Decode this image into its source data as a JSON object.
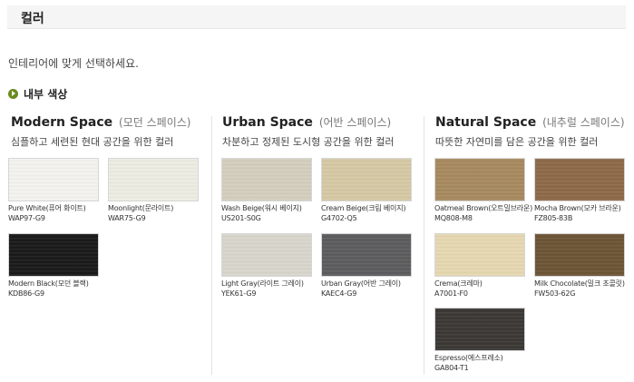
{
  "header": {
    "title": "컬러"
  },
  "intro": {
    "text": "인테리어에 맞게 선택하세요."
  },
  "subhead": {
    "label": "내부 색상"
  },
  "columns": [
    {
      "title": "Modern Space",
      "subtitle": "(모던 스페이스)",
      "desc": "심플하고 세련된 현대 공간을 위한 컬러",
      "swatches": [
        {
          "name": "Pure White(퓨어 화이트)",
          "code": "WAP97-G9",
          "color": "#f4f3ef"
        },
        {
          "name": "Moonlight(문라이트)",
          "code": "WAR75-G9",
          "color": "#eeede3"
        },
        {
          "name": "Modern Black(모던 블랙)",
          "code": "KDB86-G9",
          "color": "#1a1a1a"
        }
      ]
    },
    {
      "title": "Urban Space",
      "subtitle": "(어반 스페이스)",
      "desc": "차분하고 정제된 도시형 공간을 위한 컬러",
      "swatches": [
        {
          "name": "Wash Beige(워시 베이지)",
          "code": "US201-S0G",
          "color": "#d4cfbe"
        },
        {
          "name": "Cream Beige(크림 베이지)",
          "code": "G4702-Q5",
          "color": "#d6c9a5"
        },
        {
          "name": "Light Gray(라이트 그레이)",
          "code": "YEK61-G9",
          "color": "#d9d6cd"
        },
        {
          "name": "Urban Gray(어반 그레이)",
          "code": "KAEC4-G9",
          "color": "#5c5c5e"
        }
      ]
    },
    {
      "title": "Natural Space",
      "subtitle": "(내추럴 스페이스)",
      "desc": "따뜻한 자연미를 담은 공간을 위한 컬러",
      "swatches": [
        {
          "name": "Oatmeal Brown(오트밀브라운)",
          "code": "MQ808-M8",
          "color": "#a88a5f"
        },
        {
          "name": "Mocha Brown(모카 브라운)",
          "code": "FZ805-83B",
          "color": "#8d6a48"
        },
        {
          "name": "Crema(크레마)",
          "code": "A7001-F0",
          "color": "#e6d8b1"
        },
        {
          "name": "Milk Chocolate(밀크 초콜릿)",
          "code": "FW503-62G",
          "color": "#6d5436"
        },
        {
          "name": "Espresso(에스프레소)",
          "code": "GA804-T1",
          "color": "#3b3835"
        }
      ]
    }
  ]
}
